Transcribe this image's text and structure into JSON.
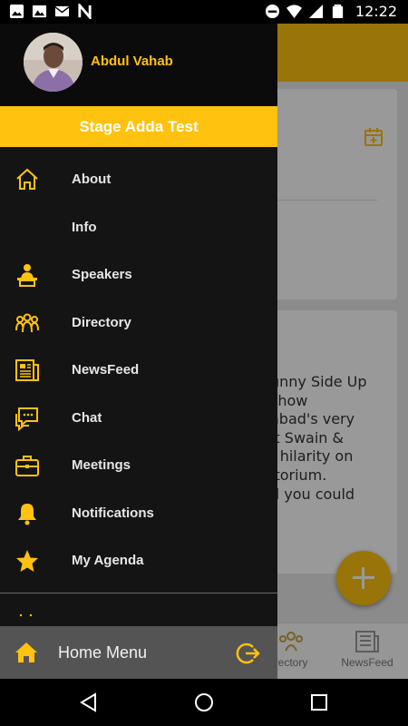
{
  "status_bar": {
    "time": "12:22",
    "left_icons": [
      "photo-icon",
      "image-icon",
      "mail-icon",
      "n-app-icon"
    ],
    "right_icons": [
      "dnd-icon",
      "wifi-icon",
      "signal-icon",
      "battery-icon"
    ]
  },
  "background": {
    "card_text": "unny Side Up\nshow\nabad's very\nit Swain &\nf hilarity on\nitorium.\nd you could",
    "bottom_nav": [
      {
        "label": "rectory",
        "icon": "directory-icon"
      },
      {
        "label": "NewsFeed",
        "icon": "newspaper-icon"
      }
    ]
  },
  "drawer": {
    "user_name": "Abdul Vahab",
    "event_title": "Stage Adda Test",
    "menu_items": [
      {
        "label": "About",
        "icon": "home-outline-icon"
      },
      {
        "label": "Info",
        "icon": ""
      },
      {
        "label": "Speakers",
        "icon": "speaker-podium-icon"
      },
      {
        "label": "Directory",
        "icon": "people-group-icon"
      },
      {
        "label": "NewsFeed",
        "icon": "newspaper-icon"
      },
      {
        "label": "Chat",
        "icon": "chat-bubbles-icon"
      },
      {
        "label": "Meetings",
        "icon": "briefcase-icon"
      },
      {
        "label": "Notifications",
        "icon": "bell-icon"
      },
      {
        "label": "My Agenda",
        "icon": "star-icon"
      }
    ],
    "home_menu_label": "Home Menu"
  },
  "colors": {
    "accent": "#ffc20e",
    "drawer_bg": "#141414",
    "home_menu_bg": "#545454"
  }
}
